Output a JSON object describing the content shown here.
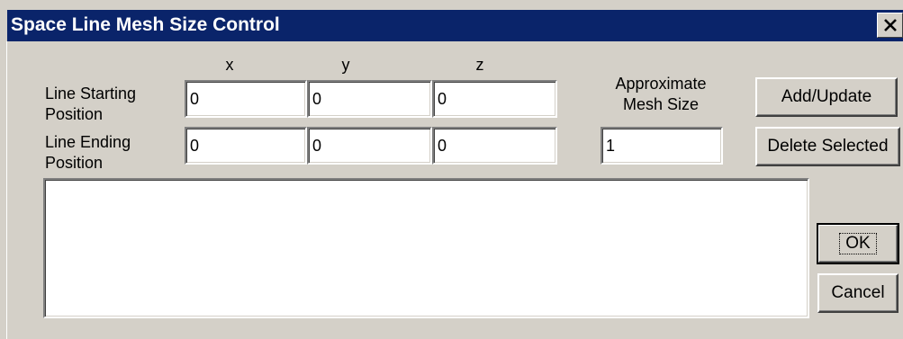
{
  "window": {
    "title": "Space Line Mesh Size Control",
    "close_label": "Close"
  },
  "columns": {
    "x": "x",
    "y": "y",
    "z": "z"
  },
  "rows": {
    "start_label_1": "Line Starting",
    "start_label_2": "Position",
    "end_label_1": "Line Ending",
    "end_label_2": "Position"
  },
  "start": {
    "x": "0",
    "y": "0",
    "z": "0"
  },
  "end": {
    "x": "0",
    "y": "0",
    "z": "0"
  },
  "mesh": {
    "label_1": "Approximate",
    "label_2": "Mesh Size",
    "value": "1"
  },
  "buttons": {
    "add_update": "Add/Update",
    "delete_selected": "Delete Selected",
    "ok": "OK",
    "cancel": "Cancel"
  },
  "list": {
    "items": []
  },
  "colors": {
    "titlebar": "#0a246a",
    "face": "#d4d0c8",
    "field": "#ffffff"
  },
  "icons": {
    "close": "close-icon"
  }
}
